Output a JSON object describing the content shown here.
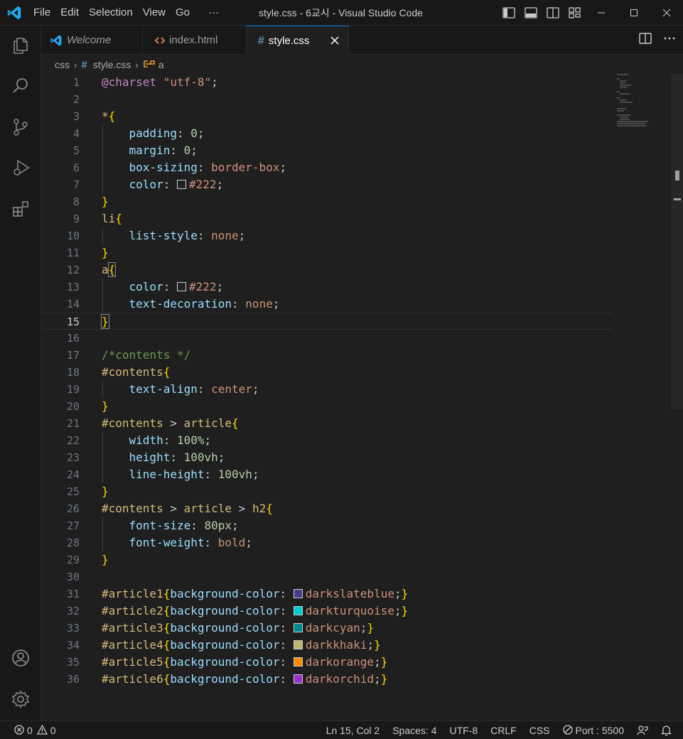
{
  "titlebar": {
    "menu": [
      "File",
      "Edit",
      "Selection",
      "View",
      "Go",
      "···"
    ],
    "window_title": "style.css - 6교시 - Visual Studio Code"
  },
  "tabs": [
    {
      "label": "Welcome",
      "icon": "vscode-logo-icon",
      "italic": true
    },
    {
      "label": "index.html",
      "icon": "html-file-icon",
      "italic": false
    },
    {
      "label": "style.css",
      "icon": "css-file-icon",
      "italic": false,
      "active": true
    }
  ],
  "breadcrumb": {
    "folder": "css",
    "file": "style.css",
    "symbol": "a"
  },
  "editor": {
    "current_line": 15,
    "lines": [
      {
        "n": "1",
        "tokens": [
          [
            "at",
            "@charset"
          ],
          [
            "pun",
            " "
          ],
          [
            "str",
            "\"utf-8\""
          ],
          [
            "pun",
            ";"
          ]
        ]
      },
      {
        "n": "2",
        "tokens": []
      },
      {
        "n": "3",
        "tokens": [
          [
            "sel",
            "*"
          ],
          [
            "brace",
            "{"
          ]
        ]
      },
      {
        "n": "4",
        "indent": true,
        "tokens": [
          [
            "pun",
            "    "
          ],
          [
            "prop",
            "padding"
          ],
          [
            "pun",
            ": "
          ],
          [
            "num",
            "0"
          ],
          [
            "pun",
            ";"
          ]
        ]
      },
      {
        "n": "5",
        "indent": true,
        "tokens": [
          [
            "pun",
            "    "
          ],
          [
            "prop",
            "margin"
          ],
          [
            "pun",
            ": "
          ],
          [
            "num",
            "0"
          ],
          [
            "pun",
            ";"
          ]
        ]
      },
      {
        "n": "6",
        "indent": true,
        "tokens": [
          [
            "pun",
            "    "
          ],
          [
            "prop",
            "box-sizing"
          ],
          [
            "pun",
            ": "
          ],
          [
            "val",
            "border-box"
          ],
          [
            "pun",
            ";"
          ]
        ]
      },
      {
        "n": "7",
        "indent": true,
        "tokens": [
          [
            "pun",
            "    "
          ],
          [
            "prop",
            "color"
          ],
          [
            "pun",
            ": "
          ],
          [
            "swatch",
            "#222222"
          ],
          [
            "val",
            "#222"
          ],
          [
            "pun",
            ";"
          ]
        ]
      },
      {
        "n": "8",
        "tokens": [
          [
            "brace",
            "}"
          ]
        ]
      },
      {
        "n": "9",
        "tokens": [
          [
            "sel",
            "li"
          ],
          [
            "brace",
            "{"
          ]
        ]
      },
      {
        "n": "10",
        "indent": true,
        "tokens": [
          [
            "pun",
            "    "
          ],
          [
            "prop",
            "list-style"
          ],
          [
            "pun",
            ": "
          ],
          [
            "val",
            "none"
          ],
          [
            "pun",
            ";"
          ]
        ]
      },
      {
        "n": "11",
        "tokens": [
          [
            "brace",
            "}"
          ]
        ]
      },
      {
        "n": "12",
        "tokens": [
          [
            "sel",
            "a"
          ],
          [
            "bracebox",
            "{"
          ]
        ]
      },
      {
        "n": "13",
        "indent": true,
        "tokens": [
          [
            "pun",
            "    "
          ],
          [
            "prop",
            "color"
          ],
          [
            "pun",
            ": "
          ],
          [
            "swatch",
            "#222222"
          ],
          [
            "val",
            "#222"
          ],
          [
            "pun",
            ";"
          ]
        ]
      },
      {
        "n": "14",
        "indent": true,
        "tokens": [
          [
            "pun",
            "    "
          ],
          [
            "prop",
            "text-decoration"
          ],
          [
            "pun",
            ": "
          ],
          [
            "val",
            "none"
          ],
          [
            "pun",
            ";"
          ]
        ]
      },
      {
        "n": "15",
        "tokens": [
          [
            "bracebox",
            "}"
          ]
        ]
      },
      {
        "n": "16",
        "tokens": []
      },
      {
        "n": "17",
        "tokens": [
          [
            "cmt",
            "/*contents */"
          ]
        ]
      },
      {
        "n": "18",
        "tokens": [
          [
            "sel",
            "#contents"
          ],
          [
            "brace",
            "{"
          ]
        ]
      },
      {
        "n": "19",
        "indent": true,
        "tokens": [
          [
            "pun",
            "    "
          ],
          [
            "prop",
            "text-align"
          ],
          [
            "pun",
            ": "
          ],
          [
            "val",
            "center"
          ],
          [
            "pun",
            ";"
          ]
        ]
      },
      {
        "n": "20",
        "tokens": [
          [
            "brace",
            "}"
          ]
        ]
      },
      {
        "n": "21",
        "tokens": [
          [
            "sel",
            "#contents"
          ],
          [
            "pun",
            " > "
          ],
          [
            "sel",
            "article"
          ],
          [
            "brace",
            "{"
          ]
        ]
      },
      {
        "n": "22",
        "indent": true,
        "tokens": [
          [
            "pun",
            "    "
          ],
          [
            "prop",
            "width"
          ],
          [
            "pun",
            ": "
          ],
          [
            "num",
            "100%"
          ],
          [
            "pun",
            ";"
          ]
        ]
      },
      {
        "n": "23",
        "indent": true,
        "tokens": [
          [
            "pun",
            "    "
          ],
          [
            "prop",
            "height"
          ],
          [
            "pun",
            ": "
          ],
          [
            "num",
            "100vh"
          ],
          [
            "pun",
            ";"
          ]
        ]
      },
      {
        "n": "24",
        "indent": true,
        "tokens": [
          [
            "pun",
            "    "
          ],
          [
            "prop",
            "line-height"
          ],
          [
            "pun",
            ": "
          ],
          [
            "num",
            "100vh"
          ],
          [
            "pun",
            ";"
          ]
        ]
      },
      {
        "n": "25",
        "tokens": [
          [
            "brace",
            "}"
          ]
        ]
      },
      {
        "n": "26",
        "tokens": [
          [
            "sel",
            "#contents"
          ],
          [
            "pun",
            " > "
          ],
          [
            "sel",
            "article"
          ],
          [
            "pun",
            " > "
          ],
          [
            "sel",
            "h2"
          ],
          [
            "brace",
            "{"
          ]
        ]
      },
      {
        "n": "27",
        "indent": true,
        "tokens": [
          [
            "pun",
            "    "
          ],
          [
            "prop",
            "font-size"
          ],
          [
            "pun",
            ": "
          ],
          [
            "num",
            "80px"
          ],
          [
            "pun",
            ";"
          ]
        ]
      },
      {
        "n": "28",
        "indent": true,
        "tokens": [
          [
            "pun",
            "    "
          ],
          [
            "prop",
            "font-weight"
          ],
          [
            "pun",
            ": "
          ],
          [
            "val",
            "bold"
          ],
          [
            "pun",
            ";"
          ]
        ]
      },
      {
        "n": "29",
        "tokens": [
          [
            "brace",
            "}"
          ]
        ]
      },
      {
        "n": "30",
        "tokens": []
      },
      {
        "n": "31",
        "tokens": [
          [
            "sel",
            "#article1"
          ],
          [
            "brace",
            "{"
          ],
          [
            "prop",
            "background-color"
          ],
          [
            "pun",
            ": "
          ],
          [
            "swatch",
            "#483d8b"
          ],
          [
            "val",
            "darkslateblue"
          ],
          [
            "pun",
            ";"
          ],
          [
            "brace",
            "}"
          ]
        ]
      },
      {
        "n": "32",
        "tokens": [
          [
            "sel",
            "#article2"
          ],
          [
            "brace",
            "{"
          ],
          [
            "prop",
            "background-color"
          ],
          [
            "pun",
            ": "
          ],
          [
            "swatch",
            "#00ced1"
          ],
          [
            "val",
            "darkturquoise"
          ],
          [
            "pun",
            ";"
          ],
          [
            "brace",
            "}"
          ]
        ]
      },
      {
        "n": "33",
        "tokens": [
          [
            "sel",
            "#article3"
          ],
          [
            "brace",
            "{"
          ],
          [
            "prop",
            "background-color"
          ],
          [
            "pun",
            ": "
          ],
          [
            "swatch",
            "#008b8b"
          ],
          [
            "val",
            "darkcyan"
          ],
          [
            "pun",
            ";"
          ],
          [
            "brace",
            "}"
          ]
        ]
      },
      {
        "n": "34",
        "tokens": [
          [
            "sel",
            "#article4"
          ],
          [
            "brace",
            "{"
          ],
          [
            "prop",
            "background-color"
          ],
          [
            "pun",
            ": "
          ],
          [
            "swatch",
            "#bdb76b"
          ],
          [
            "val",
            "darkkhaki"
          ],
          [
            "pun",
            ";"
          ],
          [
            "brace",
            "}"
          ]
        ]
      },
      {
        "n": "35",
        "tokens": [
          [
            "sel",
            "#article5"
          ],
          [
            "brace",
            "{"
          ],
          [
            "prop",
            "background-color"
          ],
          [
            "pun",
            ": "
          ],
          [
            "swatch",
            "#ff8c00"
          ],
          [
            "val",
            "darkorange"
          ],
          [
            "pun",
            ";"
          ],
          [
            "brace",
            "}"
          ]
        ]
      },
      {
        "n": "36",
        "tokens": [
          [
            "sel",
            "#article6"
          ],
          [
            "brace",
            "{"
          ],
          [
            "prop",
            "background-color"
          ],
          [
            "pun",
            ": "
          ],
          [
            "swatch",
            "#9932cc"
          ],
          [
            "val",
            "darkorchid"
          ],
          [
            "pun",
            ";"
          ],
          [
            "brace",
            "}"
          ]
        ]
      }
    ]
  },
  "statusbar": {
    "errors": "0",
    "warnings": "0",
    "position": "Ln 15, Col 2",
    "spaces": "Spaces: 4",
    "encoding": "UTF-8",
    "eol": "CRLF",
    "language": "CSS",
    "port": "Port : 5500"
  },
  "colors": {
    "accent": "#0078d4",
    "vscode_blue": "#23a9f2",
    "html_icon": "#e37933",
    "css_icon": "#519aba"
  }
}
